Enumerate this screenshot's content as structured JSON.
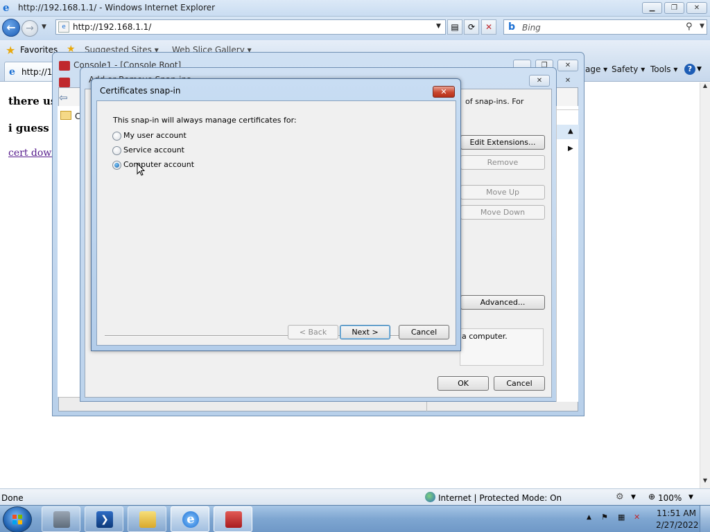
{
  "browser": {
    "window_title": "http://192.168.1.1/ - Windows Internet Explorer",
    "address": "http://192.168.1.1/",
    "search_placeholder": "Bing",
    "favorites_label": "Favorites",
    "suggested_sites": "Suggested Sites ▾",
    "web_slice_gallery": "Web Slice Gallery ▾",
    "tab_label": "http://19",
    "commands": {
      "page": "age ▾",
      "safety": "Safety ▾",
      "tools": "Tools ▾"
    },
    "status_text": "Done",
    "zone_text": "Internet | Protected Mode: On",
    "zoom": "100%"
  },
  "page": {
    "line1": "there us",
    "line2": "i guess it",
    "link": "cert downl"
  },
  "mmc": {
    "title": "Console1 - [Console Root]",
    "tree_item": "Co"
  },
  "snapins": {
    "title": "Add or Remove Snap-ins",
    "description_fragment_1": "of snap-ins. For",
    "edit_extensions": "Edit Extensions...",
    "remove": "Remove",
    "move_up": "Move Up",
    "move_down": "Move Down",
    "advanced": "Advanced...",
    "desc_box_text": "a computer.",
    "ok": "OK",
    "cancel": "Cancel"
  },
  "cert_dialog": {
    "title": "Certificates snap-in",
    "prompt": "This snap-in will always manage certificates for:",
    "options": [
      {
        "label": "My user account",
        "selected": false
      },
      {
        "label": "Service account",
        "selected": false
      },
      {
        "label": "Computer account",
        "selected": true
      }
    ],
    "back": "< Back",
    "next": "Next >",
    "cancel": "Cancel"
  },
  "taskbar": {
    "time": "11:51 AM",
    "date": "2/27/2022",
    "pinned": [
      "server-manager-icon",
      "powershell-icon",
      "explorer-icon",
      "internet-explorer-icon",
      "mmc-console-icon"
    ]
  },
  "colors": {
    "title_bar": "#c9dcf1",
    "taskbar": "#7ea6d1",
    "close_button": "#c9472f",
    "link": "#551a8b"
  }
}
